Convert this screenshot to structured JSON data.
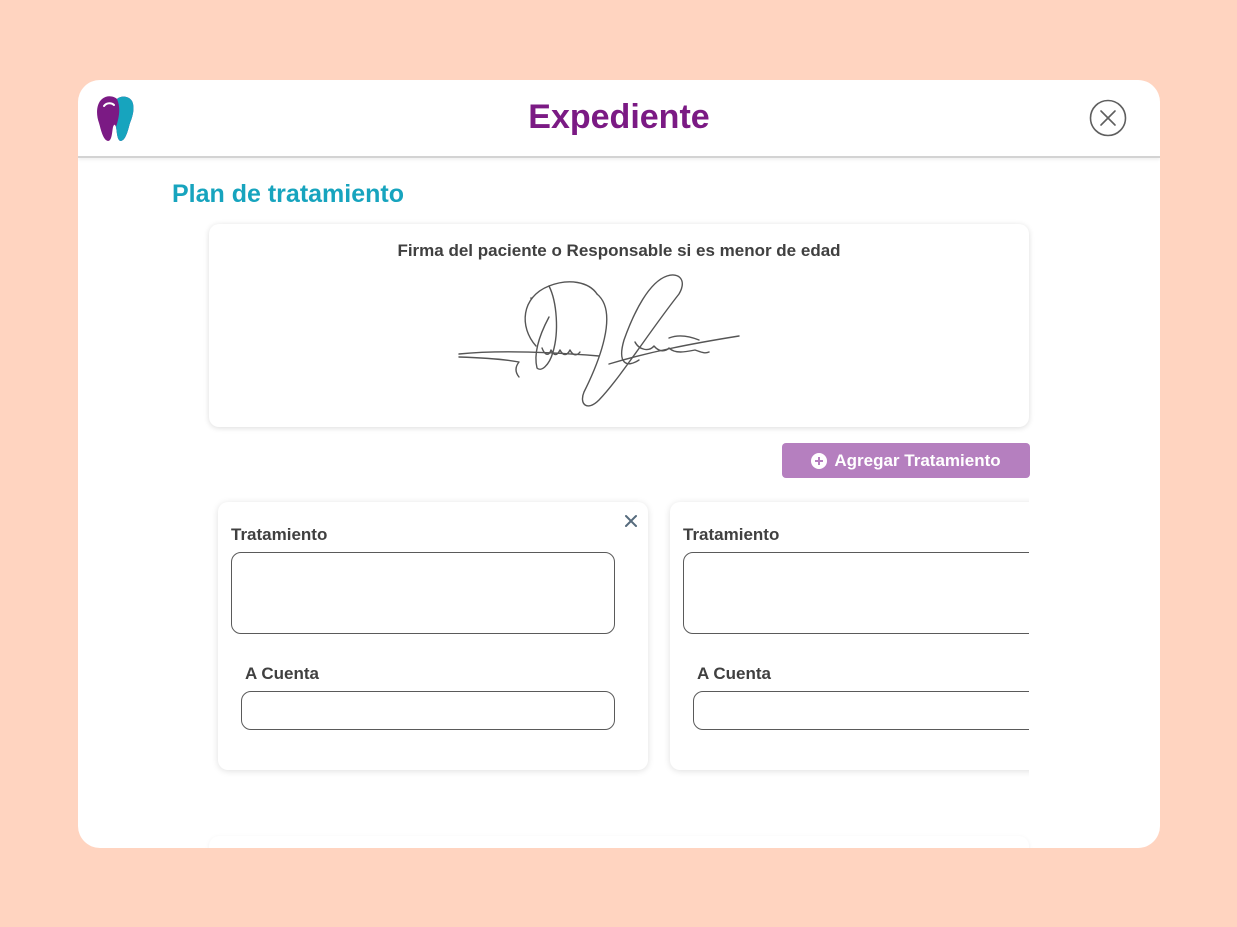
{
  "colors": {
    "page_background": "#ffd4c0",
    "brand_purple": "#7b1a84",
    "section_teal": "#17a4be",
    "button_purple": "#b57fbf",
    "label_text": "#404040"
  },
  "header": {
    "title": "Expediente",
    "logo_icon": "tooth-logo-icon",
    "close_icon": "close-circle-icon"
  },
  "section": {
    "title": "Plan de tratamiento"
  },
  "signature": {
    "label": "Firma del paciente o Responsable si es menor de edad"
  },
  "actions": {
    "add_treatment_label": "Agregar Tratamiento",
    "add_icon": "plus-circle-icon"
  },
  "treatments": [
    {
      "treatment_label": "Tratamiento",
      "treatment_value": "",
      "account_label": "A Cuenta",
      "account_value": "",
      "remove_icon": "close-icon"
    },
    {
      "treatment_label": "Tratamiento",
      "treatment_value": "",
      "account_label": "A Cuenta",
      "account_value": ""
    }
  ]
}
